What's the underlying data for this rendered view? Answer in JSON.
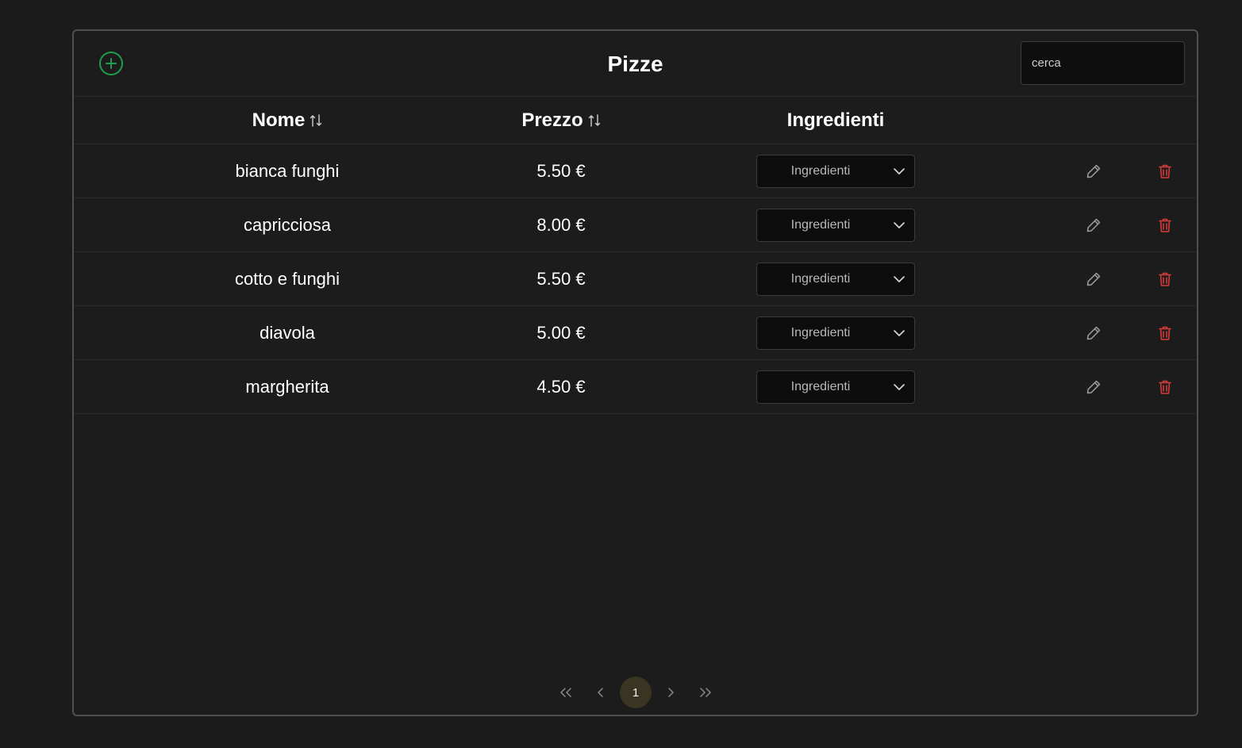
{
  "header": {
    "title": "Pizze",
    "search_placeholder": "cerca",
    "search_value": ""
  },
  "table": {
    "columns": [
      {
        "label": "Nome",
        "sortable": true
      },
      {
        "label": "Prezzo",
        "sortable": true
      },
      {
        "label": "Ingredienti",
        "sortable": false
      }
    ],
    "rows": [
      {
        "nome": "bianca funghi",
        "prezzo": "5.50 €",
        "ingredienti": "Ingredienti"
      },
      {
        "nome": "capricciosa",
        "prezzo": "8.00 €",
        "ingredienti": "Ingredienti"
      },
      {
        "nome": "cotto e funghi",
        "prezzo": "5.50 €",
        "ingredienti": "Ingredienti"
      },
      {
        "nome": "diavola",
        "prezzo": "5.00 €",
        "ingredienti": "Ingredienti"
      },
      {
        "nome": "margherita",
        "prezzo": "4.50 €",
        "ingredienti": "Ingredienti"
      }
    ]
  },
  "pagination": {
    "current_page": "1"
  },
  "icons": {
    "add": "plus-circle-icon",
    "sort": "sort-arrows-icon",
    "dropdown": "chevron-down-icon",
    "edit": "pencil-icon",
    "delete": "trash-icon",
    "first": "double-chevron-left-icon",
    "prev": "chevron-left-icon",
    "next": "chevron-right-icon",
    "last": "double-chevron-right-icon"
  },
  "colors": {
    "background": "#1b1b1c",
    "panel_border": "#4d4f55",
    "add_green": "#1f9d4c",
    "delete_red": "#d63b3b",
    "icon_gray": "#9a9a9a",
    "page_active_bg": "#3a3422"
  }
}
